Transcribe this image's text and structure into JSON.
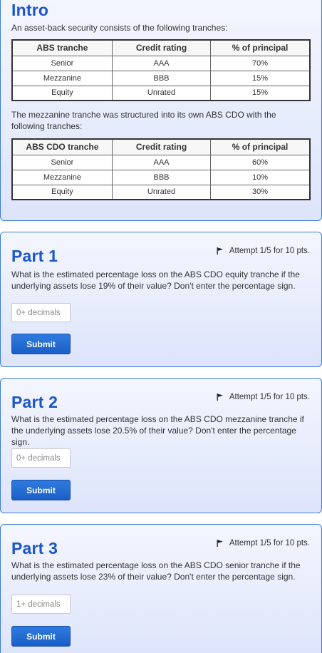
{
  "intro": {
    "title": "Intro",
    "text1": "An asset-back security consists of the following tranches:",
    "table1": {
      "headers": [
        "ABS tranche",
        "Credit rating",
        "% of principal"
      ],
      "rows": [
        [
          "Senior",
          "AAA",
          "70%"
        ],
        [
          "Mezzanine",
          "BBB",
          "15%"
        ],
        [
          "Equity",
          "Unrated",
          "15%"
        ]
      ]
    },
    "text2": "The mezzanine tranche was structured into its own ABS CDO with the following tranches:",
    "table2": {
      "headers": [
        "ABS CDO tranche",
        "Credit rating",
        "% of principal"
      ],
      "rows": [
        [
          "Senior",
          "AAA",
          "60%"
        ],
        [
          "Mezzanine",
          "BBB",
          "10%"
        ],
        [
          "Equity",
          "Unrated",
          "30%"
        ]
      ]
    }
  },
  "parts": [
    {
      "title": "Part 1",
      "attempt": "Attempt 1/5 for 10 pts.",
      "question": "What is the estimated percentage loss on the ABS CDO equity tranche if the underlying assets lose 19% of their value? Don't enter the percentage sign.",
      "placeholder": "0+ decimals",
      "submit_label": "Submit"
    },
    {
      "title": "Part 2",
      "attempt": "Attempt 1/5 for 10 pts.",
      "question": "What is the estimated percentage loss on the ABS CDO mezzanine tranche if the underlying assets lose 20.5% of their value? Don't enter the percentage sign.",
      "placeholder": "0+ decimals",
      "submit_label": "Submit"
    },
    {
      "title": "Part 3",
      "attempt": "Attempt 1/5 for 10 pts.",
      "question": "What is the estimated percentage loss on the ABS CDO senior tranche if the underlying assets lose 23% of their value? Don't enter the percentage sign.",
      "placeholder": "1+ decimals",
      "submit_label": "Submit"
    }
  ],
  "icons": {
    "attempt_flag": "flag-icon"
  },
  "colors": {
    "title": "#1a56c7",
    "card_border": "#3b7dd8",
    "button": "#1f6ad4"
  }
}
